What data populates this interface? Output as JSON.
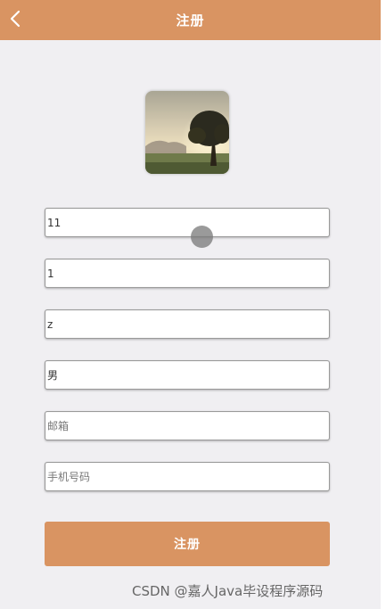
{
  "header": {
    "title": "注册",
    "back_icon": "chevron-left-icon",
    "color": "#d99462"
  },
  "avatar": {
    "image": "landscape-tree-sunset"
  },
  "form": {
    "fields": [
      {
        "value": "11",
        "placeholder": ""
      },
      {
        "value": "1",
        "placeholder": ""
      },
      {
        "value": "z",
        "placeholder": ""
      },
      {
        "value": "男",
        "placeholder": ""
      },
      {
        "value": "",
        "placeholder": "邮箱"
      },
      {
        "value": "",
        "placeholder": "手机号码"
      }
    ],
    "submit_label": "注册"
  },
  "watermark": "CSDN @嘉人Java毕设程序源码"
}
